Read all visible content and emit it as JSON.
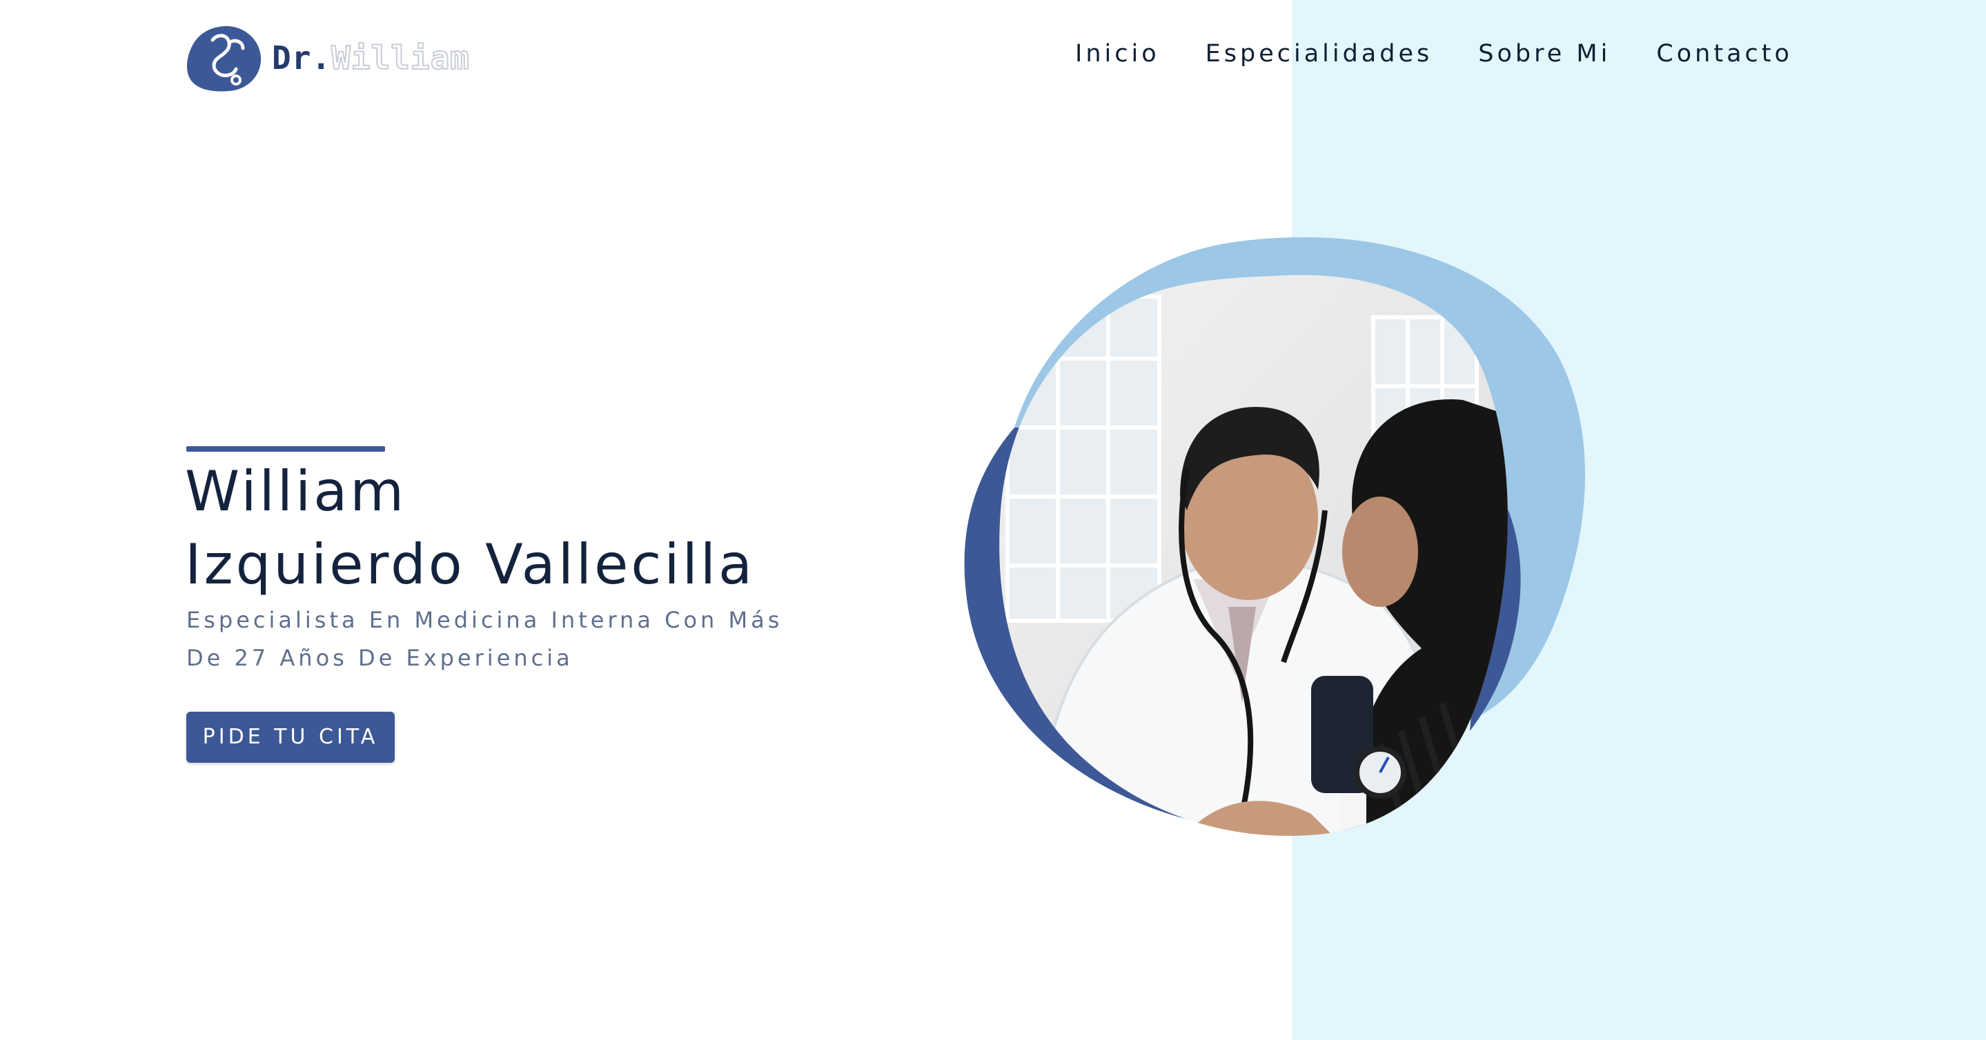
{
  "header": {
    "logo": {
      "prefix": "Dr.",
      "name": "William",
      "icon": "stethoscope-head-icon"
    },
    "nav": [
      {
        "label": "Inicio"
      },
      {
        "label": "Especialidades"
      },
      {
        "label": "Sobre Mi"
      },
      {
        "label": "Contacto"
      }
    ]
  },
  "hero": {
    "title_line1": "William",
    "title_line2": "Izquierdo Vallecilla",
    "subtitle_line1": "Especialista En Medicina Interna Con Más",
    "subtitle_line2": "De 27 Años De Experiencia",
    "cta_label": "PIDE TU CITA",
    "image_alt": "Doctor tomando la presión arterial a una paciente"
  },
  "colors": {
    "primary": "#3d5896",
    "dark_text": "#14233d",
    "muted_text": "#5e6f8c",
    "light_blue_blob": "#9cc7e6",
    "panel_background": "#e3f6fc"
  }
}
